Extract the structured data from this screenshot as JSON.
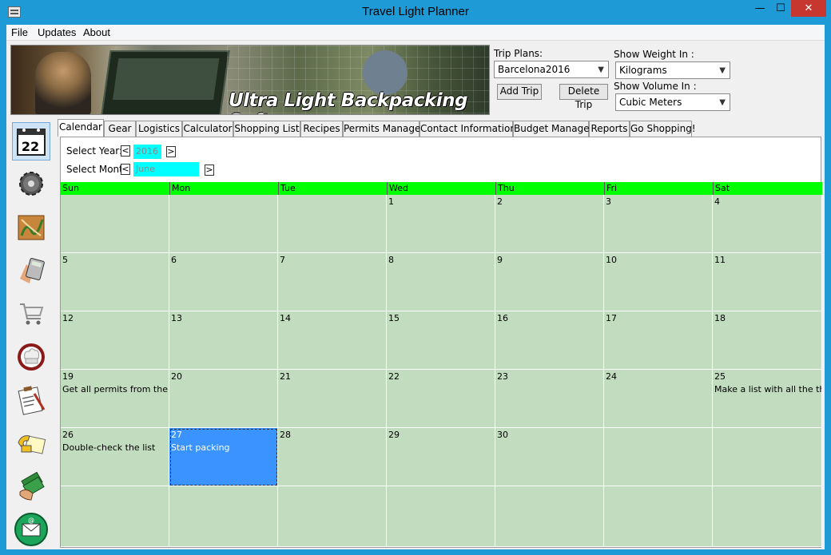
{
  "window": {
    "title": "Travel Light Planner",
    "min_glyph": "—",
    "max_glyph": "☐",
    "close_glyph": "✕"
  },
  "menu": [
    "File",
    "Updates",
    "About"
  ],
  "banner": {
    "tagline": "Ultra Light Backpacking Software"
  },
  "trip": {
    "plans_label": "Trip Plans:",
    "selected_plan": "Barcelona2016",
    "add_label": "Add Trip",
    "delete_label": "Delete Trip",
    "weight_label": "Show Weight In :",
    "weight_value": "Kilograms",
    "volume_label": "Show Volume In :",
    "volume_value": "Cubic Meters"
  },
  "sidebar_icons": [
    "calendar-icon",
    "gear-icon",
    "map-icon",
    "calculator-icon",
    "shopping-cart-icon",
    "chef-hat-icon",
    "clipboard-icon",
    "phone-contact-icon",
    "money-icon",
    "email-icon"
  ],
  "calendar_icon_date": "22",
  "tabs": [
    "Calendar",
    "Gear",
    "Logistics",
    "Calculator",
    "Shopping List",
    "Recipes",
    "Permits Manager",
    "Contact Information",
    "Budget Manager",
    "Reports",
    "Go Shopping!"
  ],
  "active_tab": "Calendar",
  "calendar": {
    "year_label": "Select Year:",
    "year_value": "2016",
    "month_label": "Select Month",
    "month_value": "June",
    "prev_glyph": "<",
    "next_glyph": ">",
    "days": [
      "Sun",
      "Mon",
      "Tue",
      "Wed",
      "Thu",
      "Fri",
      "Sat"
    ],
    "weeks": [
      [
        {
          "d": ""
        },
        {
          "d": ""
        },
        {
          "d": ""
        },
        {
          "d": "1"
        },
        {
          "d": "2"
        },
        {
          "d": "3"
        },
        {
          "d": "4"
        }
      ],
      [
        {
          "d": "5"
        },
        {
          "d": "6"
        },
        {
          "d": "7"
        },
        {
          "d": "8"
        },
        {
          "d": "9"
        },
        {
          "d": "10"
        },
        {
          "d": "11"
        }
      ],
      [
        {
          "d": "12"
        },
        {
          "d": "13"
        },
        {
          "d": "14"
        },
        {
          "d": "15"
        },
        {
          "d": "16"
        },
        {
          "d": "17"
        },
        {
          "d": "18"
        }
      ],
      [
        {
          "d": "19",
          "note": "Get all permits from the ve"
        },
        {
          "d": "20"
        },
        {
          "d": "21"
        },
        {
          "d": "22"
        },
        {
          "d": "23"
        },
        {
          "d": "24"
        },
        {
          "d": "25",
          "note": "Make a list with all the thi"
        }
      ],
      [
        {
          "d": "26",
          "note": "Double-check the list"
        },
        {
          "d": "27",
          "note": "Start packing",
          "selected": true
        },
        {
          "d": "28"
        },
        {
          "d": "29"
        },
        {
          "d": "30"
        },
        {
          "d": ""
        },
        {
          "d": ""
        }
      ],
      [
        {
          "d": ""
        },
        {
          "d": ""
        },
        {
          "d": ""
        },
        {
          "d": ""
        },
        {
          "d": ""
        },
        {
          "d": ""
        },
        {
          "d": ""
        }
      ]
    ]
  }
}
